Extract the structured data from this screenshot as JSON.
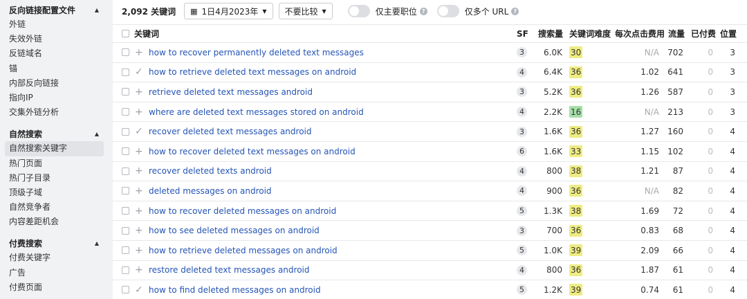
{
  "sidebar": {
    "sections": [
      {
        "title": "反向链接配置文件",
        "items": [
          "外链",
          "失效外链",
          "反链域名",
          "锚",
          "内部反向链接",
          "指向IP",
          "交集外链分析"
        ]
      },
      {
        "title": "自然搜索",
        "items": [
          "自然搜索关键字",
          "热门页面",
          "热门子目录",
          "顶级子域",
          "自然竞争者",
          "内容差距机会"
        ]
      },
      {
        "title": "付费搜索",
        "items": [
          "付费关键字",
          "广告",
          "付费页面"
        ]
      }
    ],
    "active_item": "自然搜索关键字"
  },
  "toolbar": {
    "count": "2,092 关键词",
    "date": "1日4月2023年",
    "compare": "不要比较",
    "toggle1_label": "仅主要职位",
    "toggle2_label": "仅多个 URL"
  },
  "columns": {
    "keyword": "关键词",
    "sf": "SF",
    "volume": "搜索量",
    "kd": "关键词难度",
    "cpc": "每次点击费用",
    "traffic": "流量",
    "paid": "已付费",
    "position": "位置"
  },
  "colors": {
    "kd_yellow": "#eeec82",
    "kd_green": "#a6dfa8",
    "link": "#2454b5"
  },
  "rows": [
    {
      "action": "+",
      "keyword": "how to recover permanently deleted text messages",
      "sf": "3",
      "volume": "6.0K",
      "kd": "30",
      "kd_level": "yellow",
      "cpc": "N/A",
      "traffic": "702",
      "paid": "0",
      "position": "3"
    },
    {
      "action": "✓",
      "keyword": "how to retrieve deleted text messages on android",
      "sf": "4",
      "volume": "6.4K",
      "kd": "36",
      "kd_level": "yellow",
      "cpc": "1.02",
      "traffic": "641",
      "paid": "0",
      "position": "3"
    },
    {
      "action": "+",
      "keyword": "retrieve deleted text messages android",
      "sf": "3",
      "volume": "5.2K",
      "kd": "36",
      "kd_level": "yellow",
      "cpc": "1.26",
      "traffic": "587",
      "paid": "0",
      "position": "3"
    },
    {
      "action": "+",
      "keyword": "where are deleted text messages stored on android",
      "sf": "4",
      "volume": "2.2K",
      "kd": "16",
      "kd_level": "green",
      "cpc": "N/A",
      "traffic": "213",
      "paid": "0",
      "position": "3"
    },
    {
      "action": "✓",
      "keyword": "recover deleted text messages android",
      "sf": "3",
      "volume": "1.6K",
      "kd": "36",
      "kd_level": "yellow",
      "cpc": "1.27",
      "traffic": "160",
      "paid": "0",
      "position": "4"
    },
    {
      "action": "+",
      "keyword": "how to recover deleted text messages on android",
      "sf": "6",
      "volume": "1.6K",
      "kd": "33",
      "kd_level": "yellow",
      "cpc": "1.15",
      "traffic": "102",
      "paid": "0",
      "position": "4"
    },
    {
      "action": "+",
      "keyword": "recover deleted texts android",
      "sf": "4",
      "volume": "800",
      "kd": "38",
      "kd_level": "yellow",
      "cpc": "1.21",
      "traffic": "87",
      "paid": "0",
      "position": "4"
    },
    {
      "action": "+",
      "keyword": "deleted messages on android",
      "sf": "4",
      "volume": "900",
      "kd": "36",
      "kd_level": "yellow",
      "cpc": "N/A",
      "traffic": "82",
      "paid": "0",
      "position": "4"
    },
    {
      "action": "+",
      "keyword": "how to recover deleted messages on android",
      "sf": "5",
      "volume": "1.3K",
      "kd": "38",
      "kd_level": "yellow",
      "cpc": "1.69",
      "traffic": "72",
      "paid": "0",
      "position": "4"
    },
    {
      "action": "+",
      "keyword": "how to see deleted messages on android",
      "sf": "3",
      "volume": "700",
      "kd": "36",
      "kd_level": "yellow",
      "cpc": "0.83",
      "traffic": "68",
      "paid": "0",
      "position": "4"
    },
    {
      "action": "+",
      "keyword": "how to retrieve deleted messages on android",
      "sf": "5",
      "volume": "1.0K",
      "kd": "39",
      "kd_level": "yellow",
      "cpc": "2.09",
      "traffic": "66",
      "paid": "0",
      "position": "4"
    },
    {
      "action": "+",
      "keyword": "restore deleted text messages android",
      "sf": "4",
      "volume": "800",
      "kd": "36",
      "kd_level": "yellow",
      "cpc": "1.87",
      "traffic": "61",
      "paid": "0",
      "position": "4"
    },
    {
      "action": "✓",
      "keyword": "how to find deleted messages on android",
      "sf": "5",
      "volume": "1.2K",
      "kd": "39",
      "kd_level": "yellow",
      "cpc": "0.74",
      "traffic": "61",
      "paid": "0",
      "position": "4"
    }
  ]
}
